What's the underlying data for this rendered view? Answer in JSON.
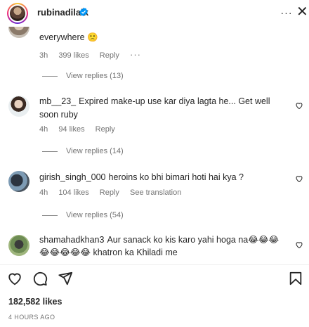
{
  "header": {
    "username": "rubinadilaik",
    "more": "···",
    "close": "✕"
  },
  "comments": [
    {
      "text": "everywhere 🙁",
      "time": "3h",
      "likes": "399 likes",
      "reply": "Reply",
      "more": "···",
      "view_replies": "View replies (13)"
    },
    {
      "username": "mb__23_",
      "text": "Expired make-up use kar diya lagta he... Get well soon ruby",
      "time": "4h",
      "likes": "94 likes",
      "reply": "Reply",
      "view_replies": "View replies (14)"
    },
    {
      "username": "girish_singh_000",
      "text": "heroins ko bhi bimari hoti hai kya ?",
      "time": "4h",
      "likes": "104 likes",
      "reply": "Reply",
      "translate": "See translation",
      "view_replies": "View replies (54)"
    },
    {
      "username": "shamahadkhan3",
      "text": "Aur sanack ko kis karo yahi hoga na😂😂😂",
      "text2": "😂😂😂😂😂 khatron ka Khiladi me"
    }
  ],
  "footer": {
    "likes": "182,582 likes",
    "time": "4 HOURS AGO"
  },
  "colors": {
    "verified": "#0095f6",
    "muted": "#737373",
    "text": "#262626"
  }
}
